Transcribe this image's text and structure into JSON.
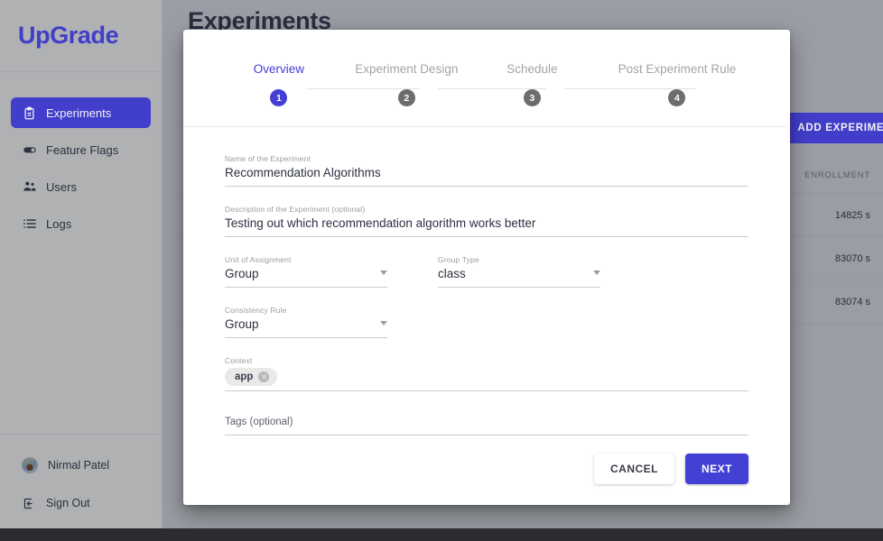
{
  "app": {
    "brand": "UpGrade",
    "page_title": "Experiments"
  },
  "sidebar": {
    "items": [
      {
        "label": "Experiments",
        "icon": "clipboard-icon",
        "active": true
      },
      {
        "label": "Feature Flags",
        "icon": "toggle-icon",
        "active": false
      },
      {
        "label": "Users",
        "icon": "people-icon",
        "active": false
      },
      {
        "label": "Logs",
        "icon": "list-icon",
        "active": false
      }
    ],
    "user": {
      "name": "Nirmal Patel",
      "icon": "avatar"
    },
    "sign_out": {
      "label": "Sign Out",
      "icon": "sign-out-icon"
    }
  },
  "background": {
    "add_experiment_label": "ADD EXPERIMENT",
    "add_experiment_icon": "plus-icon",
    "table": {
      "header": [
        "ENROLLMENT"
      ],
      "rows": [
        "14825 s",
        "83070 s",
        "83074 s"
      ]
    }
  },
  "modal": {
    "stepper": {
      "steps": [
        {
          "label": "Overview",
          "number": "1",
          "active": true
        },
        {
          "label": "Experiment Design",
          "number": "2",
          "active": false
        },
        {
          "label": "Schedule",
          "number": "3",
          "active": false
        },
        {
          "label": "Post Experiment Rule",
          "number": "4",
          "active": false
        }
      ]
    },
    "fields": {
      "name": {
        "label": "Name of the Experiment",
        "value": "Recommendation Algorithms"
      },
      "description": {
        "label": "Description of the Experiment (optional)",
        "value": "Testing out which recommendation algorithm works better"
      },
      "unit_of_assignment": {
        "label": "Unit of Assignment",
        "value": "Group"
      },
      "group_type": {
        "label": "Group Type",
        "value": "class"
      },
      "consistency_rule": {
        "label": "Consistency Rule",
        "value": "Group"
      },
      "context": {
        "label": "Context",
        "chips": [
          {
            "label": "app",
            "remove_icon": "close-circle-icon"
          }
        ]
      },
      "tags": {
        "label": "Tags (optional)",
        "value": ""
      }
    },
    "buttons": {
      "cancel": "CANCEL",
      "next": "NEXT"
    }
  },
  "colors": {
    "brand": "#4340d6",
    "accent": "#4340d6",
    "inactive_step": "#6d6d6d",
    "label_gray": "#9b9da3"
  }
}
